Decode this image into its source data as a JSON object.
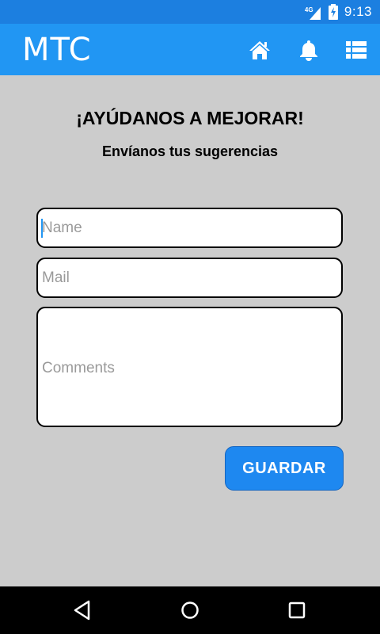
{
  "status_bar": {
    "network": "4G",
    "time": "9:13"
  },
  "app_bar": {
    "title": "MTC",
    "icons": [
      "home-icon",
      "bell-icon",
      "list-icon"
    ]
  },
  "form": {
    "heading": "¡AYÚDANOS A MEJORAR!",
    "subheading": "Envíanos tus sugerencias",
    "name_placeholder": "Name",
    "name_value": "",
    "mail_placeholder": "Mail",
    "mail_value": "",
    "comments_placeholder": "Comments",
    "comments_value": "",
    "save_label": "GUARDAR"
  },
  "nav_bar": {
    "buttons": [
      "back-icon",
      "home-circle-icon",
      "recents-icon"
    ]
  },
  "colors": {
    "status_bar": "#1c7fe0",
    "app_bar": "#2196f3",
    "background": "#cccccc",
    "button": "#1e88f0",
    "nav_bar": "#000000"
  }
}
